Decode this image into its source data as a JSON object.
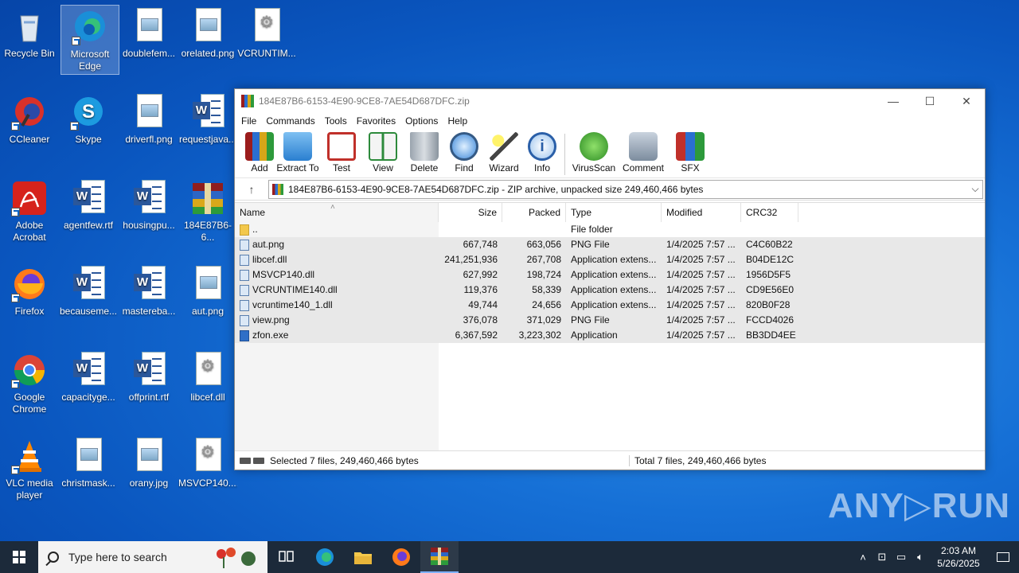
{
  "desktop": {
    "icons": [
      {
        "label": "Recycle Bin"
      },
      {
        "label": "Microsoft Edge"
      },
      {
        "label": "doublefem..."
      },
      {
        "label": "orelated.png"
      },
      {
        "label": "VCRUNTIM..."
      },
      {
        "label": "CCleaner"
      },
      {
        "label": "Skype"
      },
      {
        "label": "driverfl.png"
      },
      {
        "label": "requestjava..."
      },
      {
        "label": "Adobe Acrobat"
      },
      {
        "label": "agentfew.rtf"
      },
      {
        "label": "housingpu..."
      },
      {
        "label": "184E87B6-6..."
      },
      {
        "label": "Firefox"
      },
      {
        "label": "becauseme..."
      },
      {
        "label": "mastereba..."
      },
      {
        "label": "aut.png"
      },
      {
        "label": "Google Chrome"
      },
      {
        "label": "capacityge..."
      },
      {
        "label": "offprint.rtf"
      },
      {
        "label": "libcef.dll"
      },
      {
        "label": "VLC media player"
      },
      {
        "label": "christmask..."
      },
      {
        "label": "orany.jpg"
      },
      {
        "label": "MSVCP140...."
      }
    ]
  },
  "window": {
    "title": "184E87B6-6153-4E90-9CE8-7AE54D687DFC.zip",
    "menu": [
      "File",
      "Commands",
      "Tools",
      "Favorites",
      "Options",
      "Help"
    ],
    "toolbar": [
      "Add",
      "Extract To",
      "Test",
      "View",
      "Delete",
      "Find",
      "Wizard",
      "Info",
      "VirusScan",
      "Comment",
      "SFX"
    ],
    "address": "184E87B6-6153-4E90-9CE8-7AE54D687DFC.zip - ZIP archive, unpacked size 249,460,466 bytes",
    "columns": {
      "name": "Name",
      "size": "Size",
      "packed": "Packed",
      "type": "Type",
      "modified": "Modified",
      "crc": "CRC32"
    },
    "rows": [
      {
        "name": "..",
        "size": "",
        "packed": "",
        "type": "File folder",
        "modified": "",
        "crc": "",
        "icon": "folder"
      },
      {
        "name": "aut.png",
        "size": "667,748",
        "packed": "663,056",
        "type": "PNG File",
        "modified": "1/4/2025 7:57 ...",
        "crc": "C4C60B22",
        "icon": "file"
      },
      {
        "name": "libcef.dll",
        "size": "241,251,936",
        "packed": "267,708",
        "type": "Application extens...",
        "modified": "1/4/2025 7:57 ...",
        "crc": "B04DE12C",
        "icon": "file"
      },
      {
        "name": "MSVCP140.dll",
        "size": "627,992",
        "packed": "198,724",
        "type": "Application extens...",
        "modified": "1/4/2025 7:57 ...",
        "crc": "1956D5F5",
        "icon": "file"
      },
      {
        "name": "VCRUNTIME140.dll",
        "size": "119,376",
        "packed": "58,339",
        "type": "Application extens...",
        "modified": "1/4/2025 7:57 ...",
        "crc": "CD9E56E0",
        "icon": "file"
      },
      {
        "name": "vcruntime140_1.dll",
        "size": "49,744",
        "packed": "24,656",
        "type": "Application extens...",
        "modified": "1/4/2025 7:57 ...",
        "crc": "820B0F28",
        "icon": "file"
      },
      {
        "name": "view.png",
        "size": "376,078",
        "packed": "371,029",
        "type": "PNG File",
        "modified": "1/4/2025 7:57 ...",
        "crc": "FCCD4026",
        "icon": "file"
      },
      {
        "name": "zfon.exe",
        "size": "6,367,592",
        "packed": "3,223,302",
        "type": "Application",
        "modified": "1/4/2025 7:57 ...",
        "crc": "BB3DD4EE",
        "icon": "exe"
      }
    ],
    "status_selected": "Selected 7 files, 249,460,466 bytes",
    "status_total": "Total 7 files, 249,460,466 bytes"
  },
  "taskbar": {
    "search_placeholder": "Type here to search",
    "time": "2:03 AM",
    "date": "5/26/2025"
  },
  "watermark": "ANY RUN"
}
